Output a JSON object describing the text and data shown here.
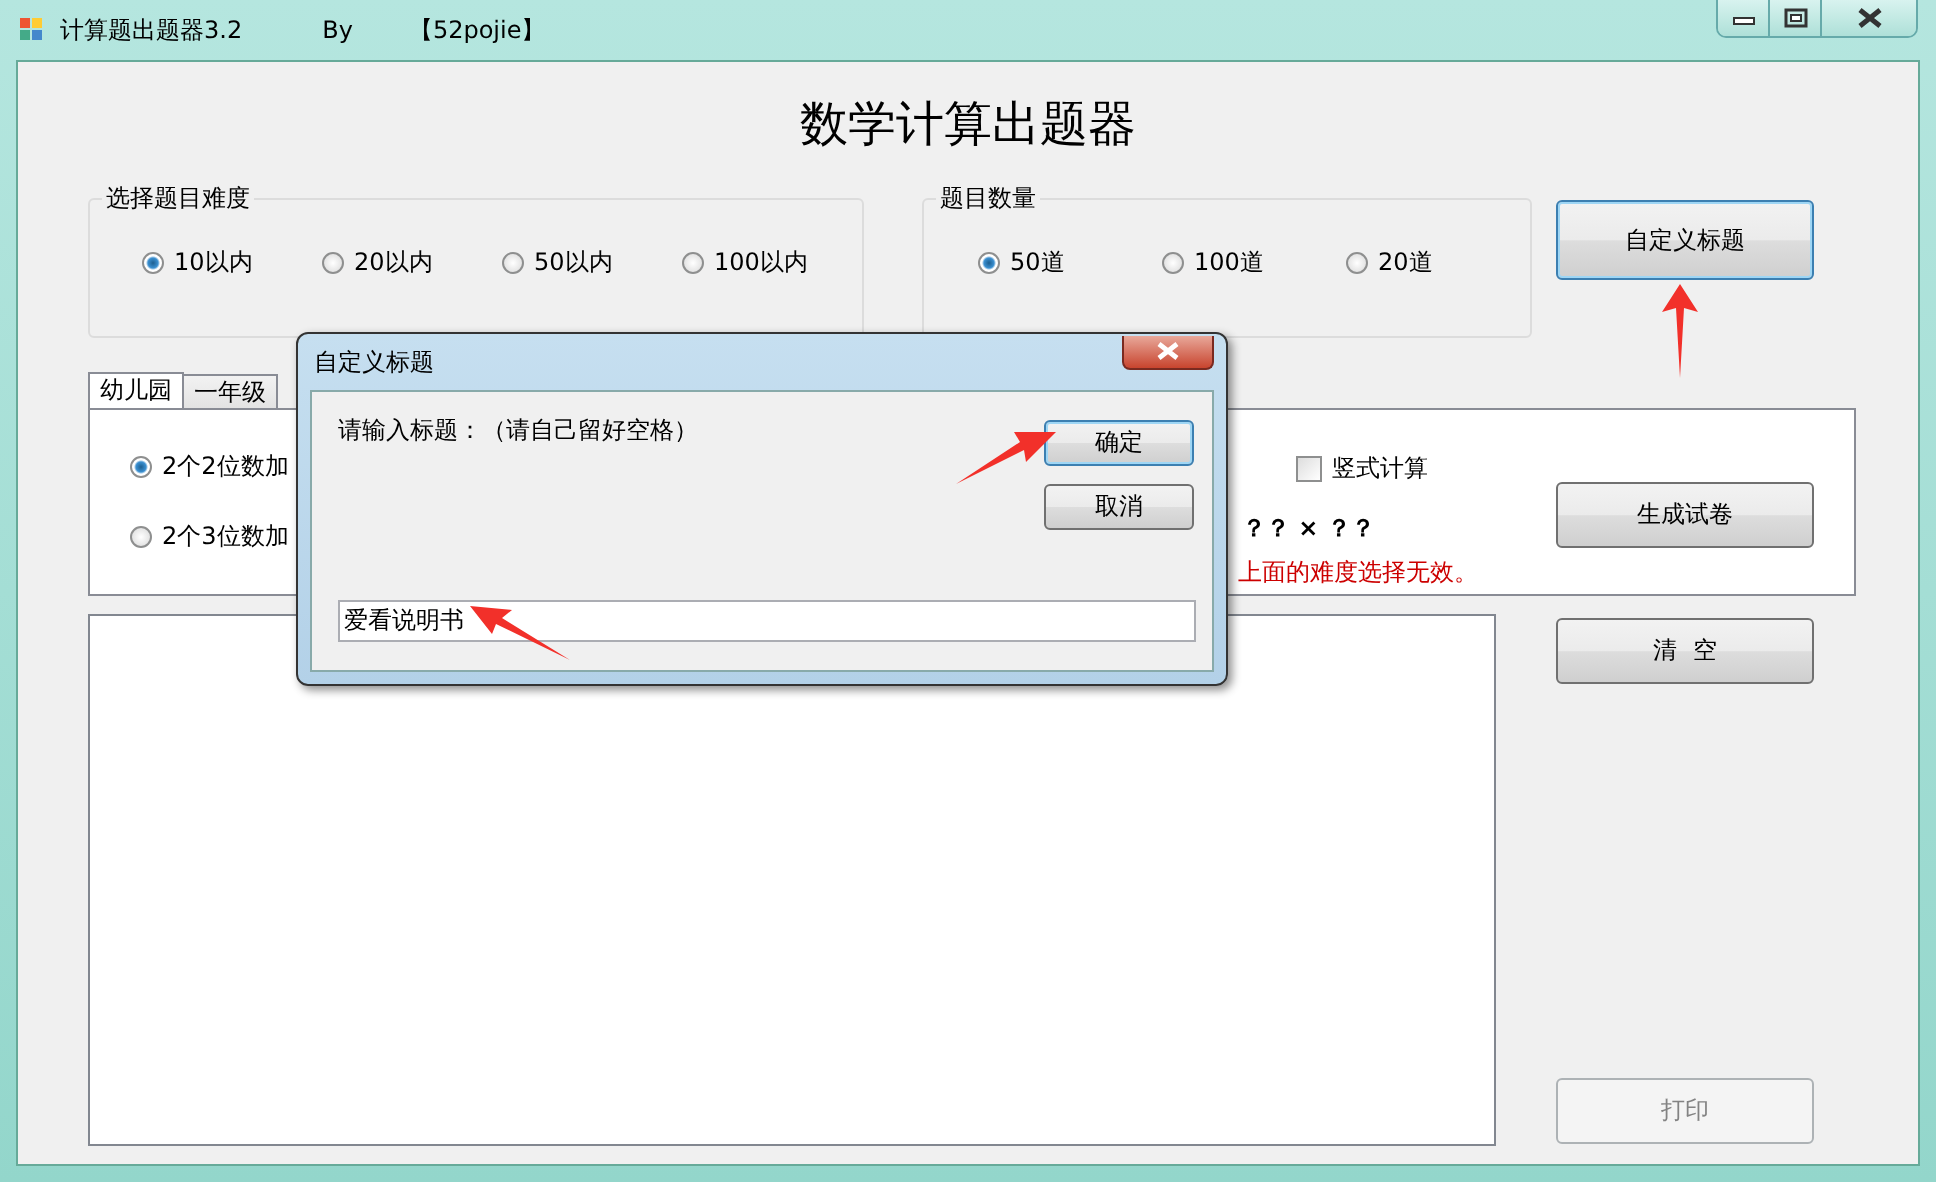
{
  "window": {
    "title": "计算题出题器3.2",
    "by": "By",
    "author": "【52pojie】"
  },
  "heading": "数学计算出题器",
  "difficulty_group": {
    "title": "选择题目难度",
    "options": [
      {
        "label": "10以内",
        "selected": true
      },
      {
        "label": "20以内",
        "selected": false
      },
      {
        "label": "50以内",
        "selected": false
      },
      {
        "label": "100以内",
        "selected": false
      }
    ]
  },
  "count_group": {
    "title": "题目数量",
    "options": [
      {
        "label": "50道",
        "selected": true
      },
      {
        "label": "100道",
        "selected": false
      },
      {
        "label": "20道",
        "selected": false
      }
    ]
  },
  "tabs": [
    {
      "label": "幼儿园",
      "selected": true
    },
    {
      "label": "一年级",
      "selected": false
    }
  ],
  "tab_panel": {
    "options": [
      {
        "label": "2个2位数加",
        "selected": true
      },
      {
        "label": "2个3位数加",
        "selected": false
      }
    ],
    "multiply_label": "？？ × ？？",
    "vertical_checkbox": {
      "label": "竖式计算",
      "checked": false
    },
    "note": "上面的难度选择无效。"
  },
  "side_buttons": [
    {
      "label": "自定义标题",
      "disabled": false
    },
    {
      "label": "生成试卷",
      "disabled": false
    },
    {
      "label": "清  空",
      "disabled": false
    },
    {
      "label": "打印",
      "disabled": true
    }
  ],
  "dialog": {
    "title": "自定义标题",
    "prompt": "请输入标题：（请自己留好空格）",
    "ok": "确定",
    "cancel": "取消",
    "value": "爱看说明书"
  }
}
